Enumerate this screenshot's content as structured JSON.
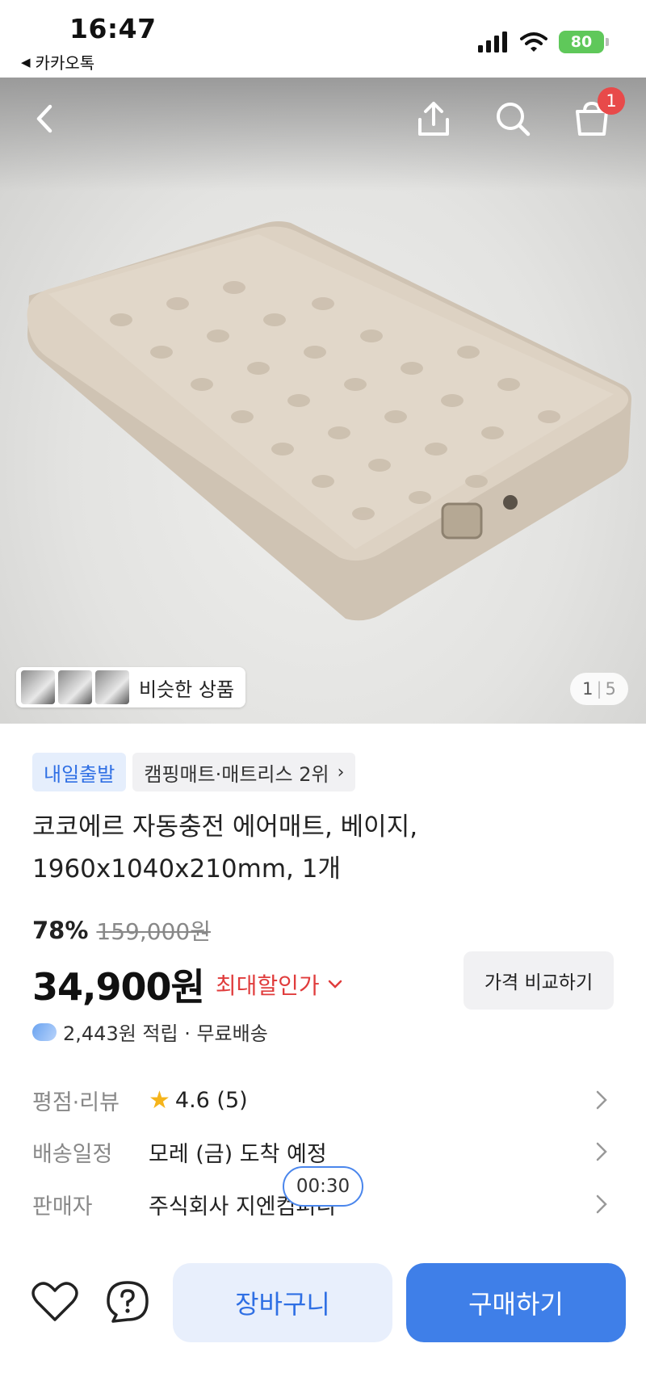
{
  "status_bar": {
    "time": "16:47",
    "back_app": "카카오톡",
    "battery": "80"
  },
  "icons": {
    "back": "chevron-left-icon",
    "share": "share-icon",
    "search": "search-icon",
    "cart": "shopping-bag-icon",
    "heart": "heart-icon",
    "help": "question-icon"
  },
  "header": {
    "cart_count": "1"
  },
  "gallery": {
    "similar_label": "비슷한 상품",
    "current": "1",
    "separator": "|",
    "total": "5"
  },
  "product": {
    "tag_delivery": "내일출발",
    "tag_rank": "캠핑매트·매트리스 2위",
    "title": "코코에르 자동충전 에어매트, 베이지, 1960x1040x210mm, 1개",
    "discount": "78%",
    "original_price": "159,000원",
    "price": "34,900원",
    "max_discount_label": "최대할인가",
    "compare_button": "가격 비교하기",
    "points": "2,443원 적립 · 무료배송"
  },
  "info": {
    "rating_label": "평점·리뷰",
    "rating_value": "4.6 (5)",
    "shipping_label": "배송일정",
    "shipping_value": "모레 (금) 도착 예정",
    "seller_label": "판매자",
    "seller_value": "주식회사 지엔컴퍼니"
  },
  "timer": "00:30",
  "bottom": {
    "cart_button": "장바구니",
    "buy_button": "구매하기"
  },
  "colors": {
    "accent": "#3f7fe8",
    "sale": "#e03c3c",
    "badge": "#e84a4a",
    "battery": "#5fc85a"
  }
}
